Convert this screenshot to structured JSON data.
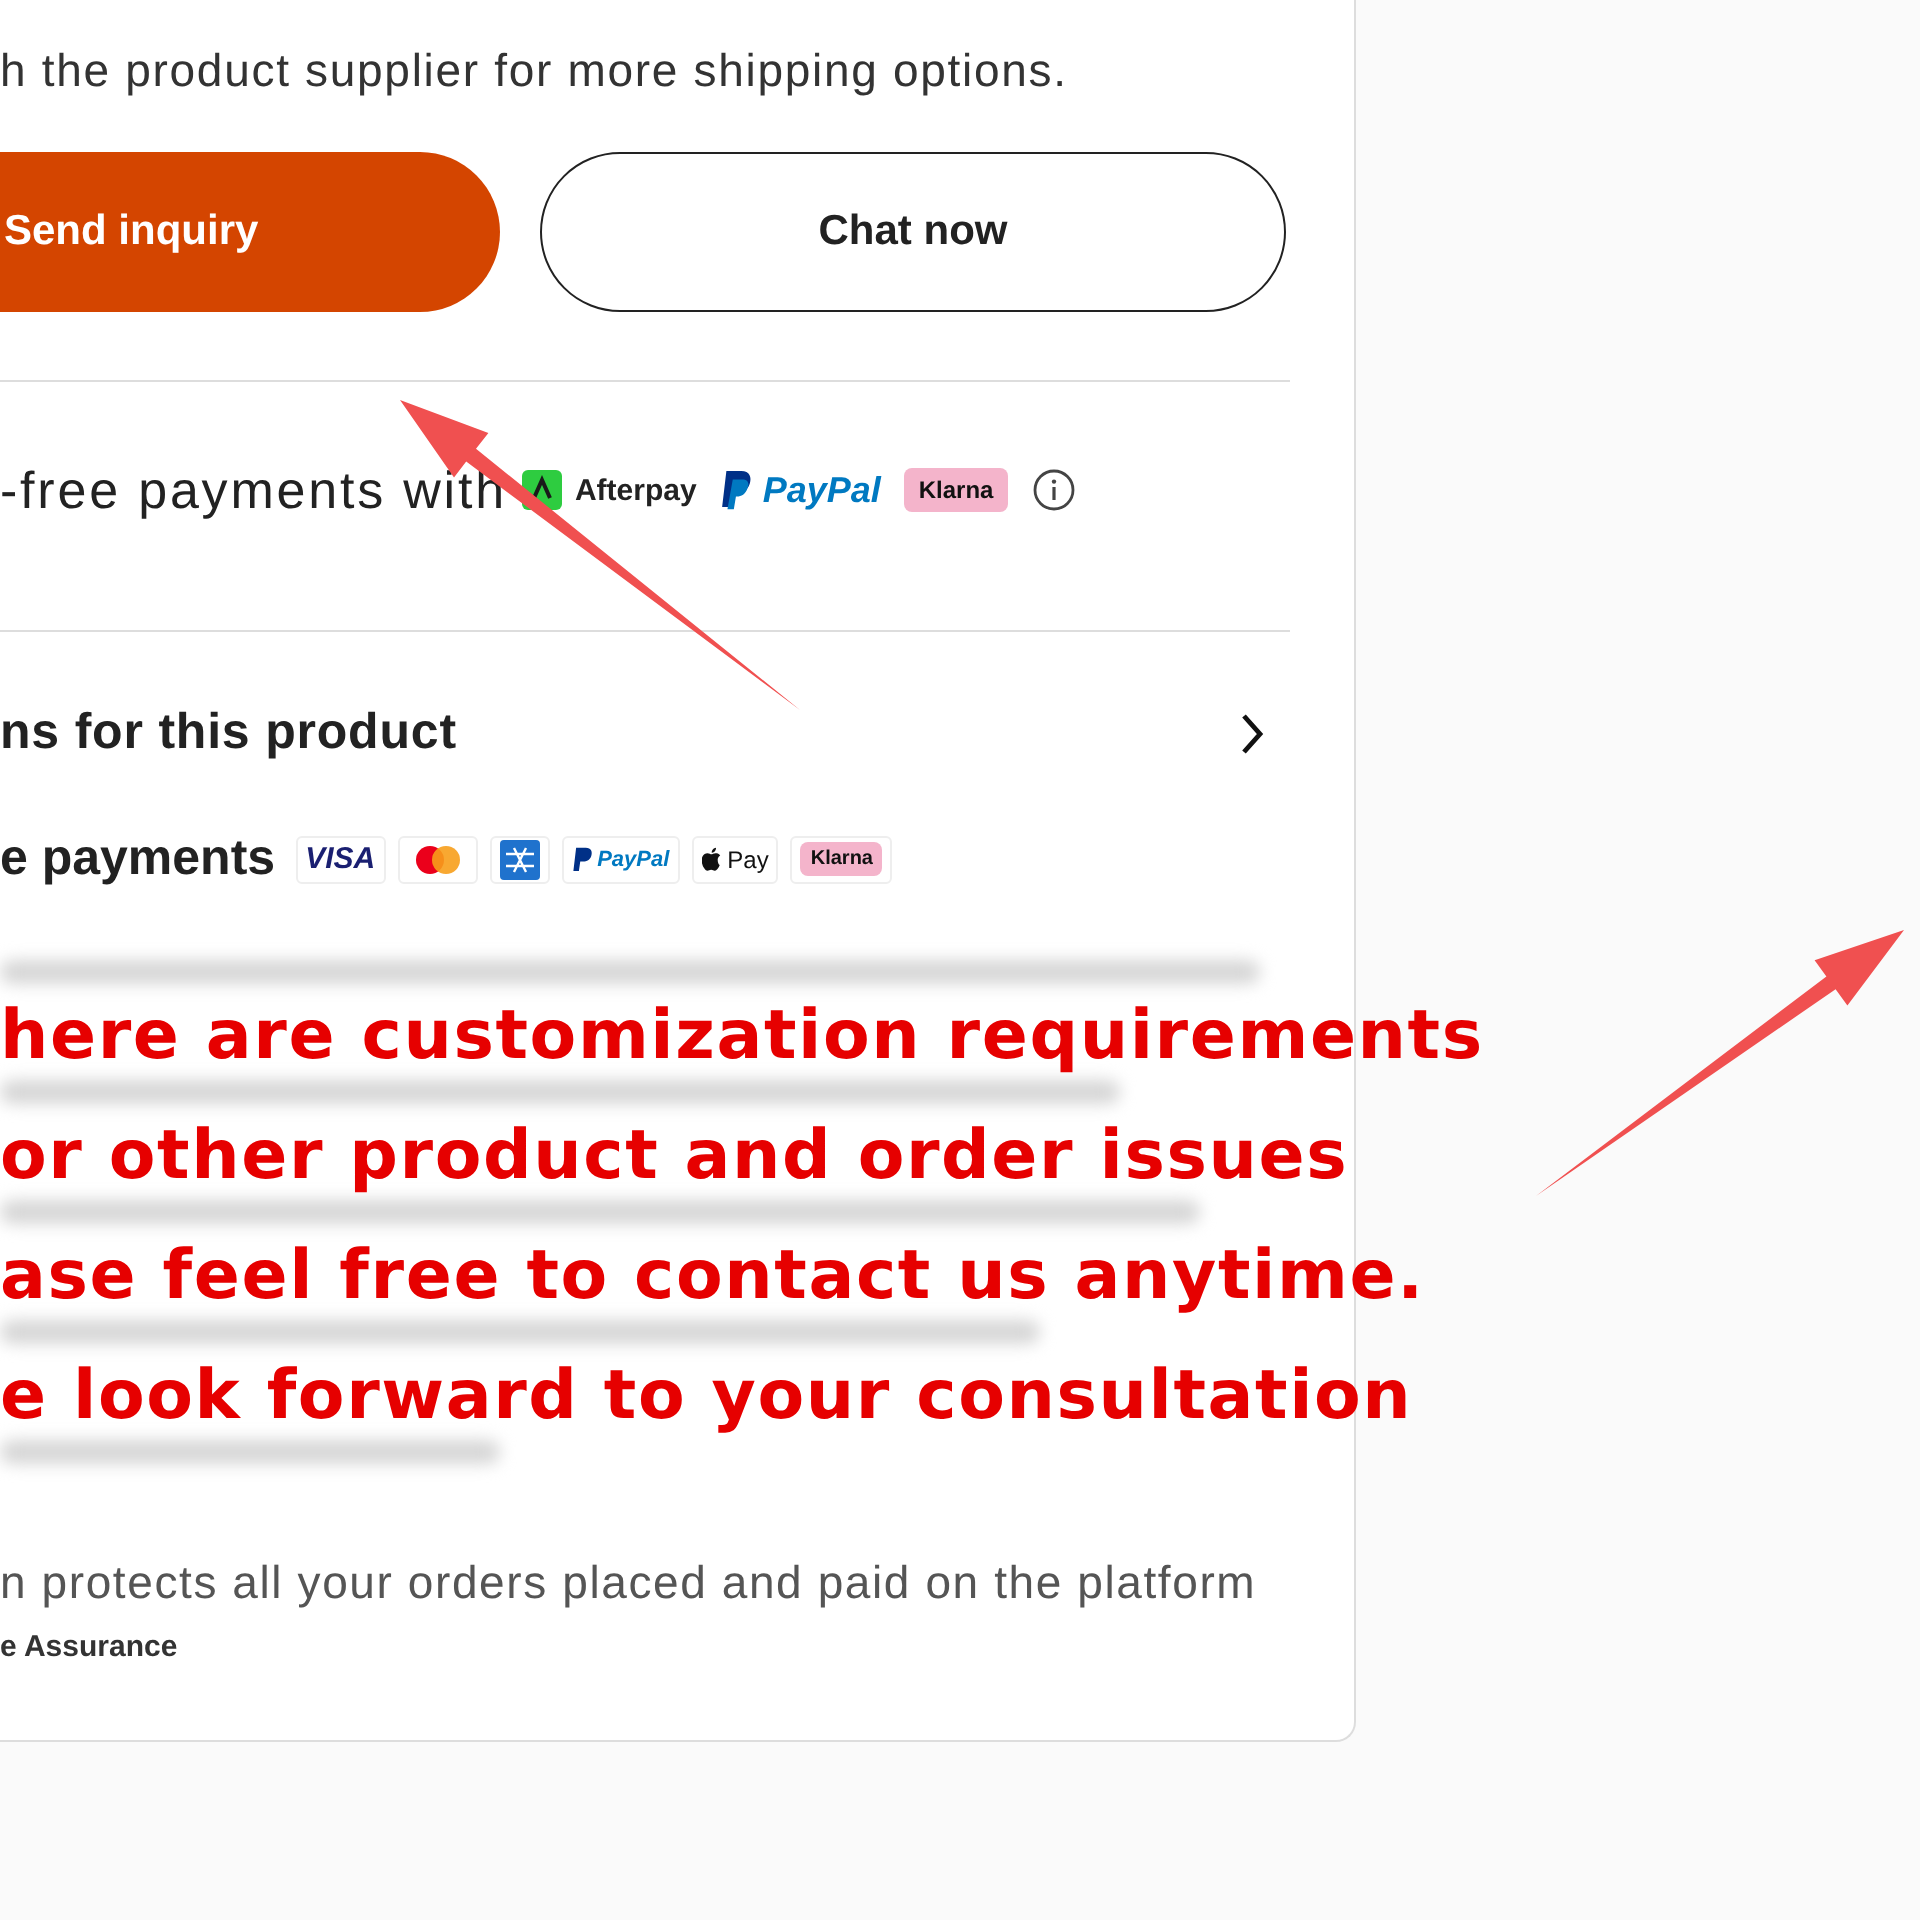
{
  "shipping_note": "h the product supplier for more shipping options.",
  "buttons": [
    {
      "label": "Send inquiry",
      "kind": "primary"
    },
    {
      "label": "Chat now",
      "kind": "secondary"
    }
  ],
  "installments": {
    "text": "-free payments with",
    "providers": [
      {
        "kind": "afterpay",
        "label": "Afterpay"
      },
      {
        "kind": "paypal",
        "label": "PayPal"
      },
      {
        "kind": "klarna",
        "label": "Klarna"
      }
    ]
  },
  "options_row": {
    "label": "ns for this product"
  },
  "secure_payments": {
    "label": "e payments",
    "methods": [
      {
        "kind": "visa",
        "label": "VISA"
      },
      {
        "kind": "mastercard"
      },
      {
        "kind": "amex"
      },
      {
        "kind": "paypal",
        "label": "PayPal"
      },
      {
        "kind": "applepay",
        "label": "Pay"
      },
      {
        "kind": "klarna",
        "label": "Klarna"
      }
    ]
  },
  "protection": {
    "text": "n protects all your orders placed and paid on the platform",
    "brand": "e Assurance"
  },
  "annotation": {
    "lines": [
      "here are customization requirements",
      "or other product and order issues",
      "ase feel free to contact us anytime.",
      "e look forward to your consultation"
    ]
  }
}
